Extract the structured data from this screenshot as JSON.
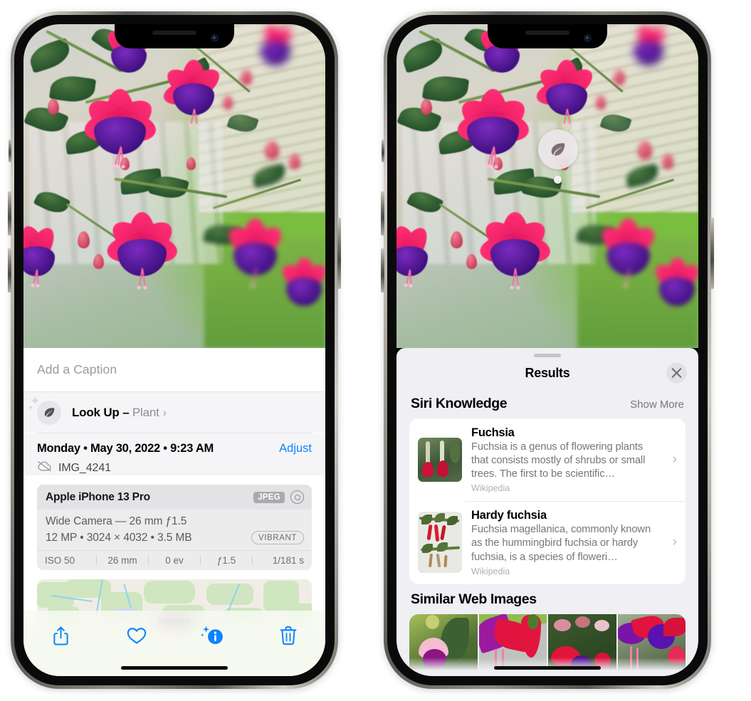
{
  "left_phone": {
    "name": "photos-info-screen",
    "caption": {
      "placeholder": "Add a Caption",
      "value": ""
    },
    "lookup": {
      "label": "Look Up – ",
      "subject": "Plant",
      "icon": "leaf-icon",
      "chevron": "›"
    },
    "meta": {
      "date": "Monday • May 30, 2022 • 9:23 AM",
      "adjust_label": "Adjust",
      "filename": "IMG_4241",
      "cloud_icon": "icloud-slash-icon"
    },
    "camera_card": {
      "device": "Apple iPhone 13 Pro",
      "format_badge": "JPEG",
      "raw_icon": "aperture-icon",
      "lens_line": "Wide Camera — 26 mm ƒ1.5",
      "size_line": "12 MP • 3024 × 4032 • 3.5 MB",
      "style_badge": "VIBRANT",
      "exif": [
        "ISO 50",
        "26 mm",
        "0 ev",
        "ƒ1.5",
        "1/181 s"
      ]
    },
    "toolbar": [
      {
        "name": "share-button",
        "icon": "share-icon"
      },
      {
        "name": "favorite-button",
        "icon": "heart-icon"
      },
      {
        "name": "info-button",
        "icon": "info-sparkle-icon"
      },
      {
        "name": "delete-button",
        "icon": "trash-icon"
      }
    ],
    "accent_color": "#0a84ff"
  },
  "right_phone": {
    "name": "visual-look-up-results",
    "badge": {
      "icon": "leaf-icon",
      "name": "visual-lookup-badge"
    },
    "results": {
      "title": "Results",
      "close_icon": "close-icon"
    },
    "siri_knowledge": {
      "title": "Siri Knowledge",
      "show_more": "Show More",
      "entries": [
        {
          "title": "Fuchsia",
          "description": "Fuchsia is a genus of flowering plants that consists mostly of shrubs or small trees. The first to be scientific…",
          "source": "Wikipedia",
          "chevron": "›"
        },
        {
          "title": "Hardy fuchsia",
          "description": "Fuchsia magellanica, commonly known as the hummingbird fuchsia or hardy fuchsia, is a species of floweri…",
          "source": "Wikipedia",
          "chevron": "›"
        }
      ]
    },
    "similar_web_images": {
      "title": "Similar Web Images",
      "count": 4
    }
  }
}
